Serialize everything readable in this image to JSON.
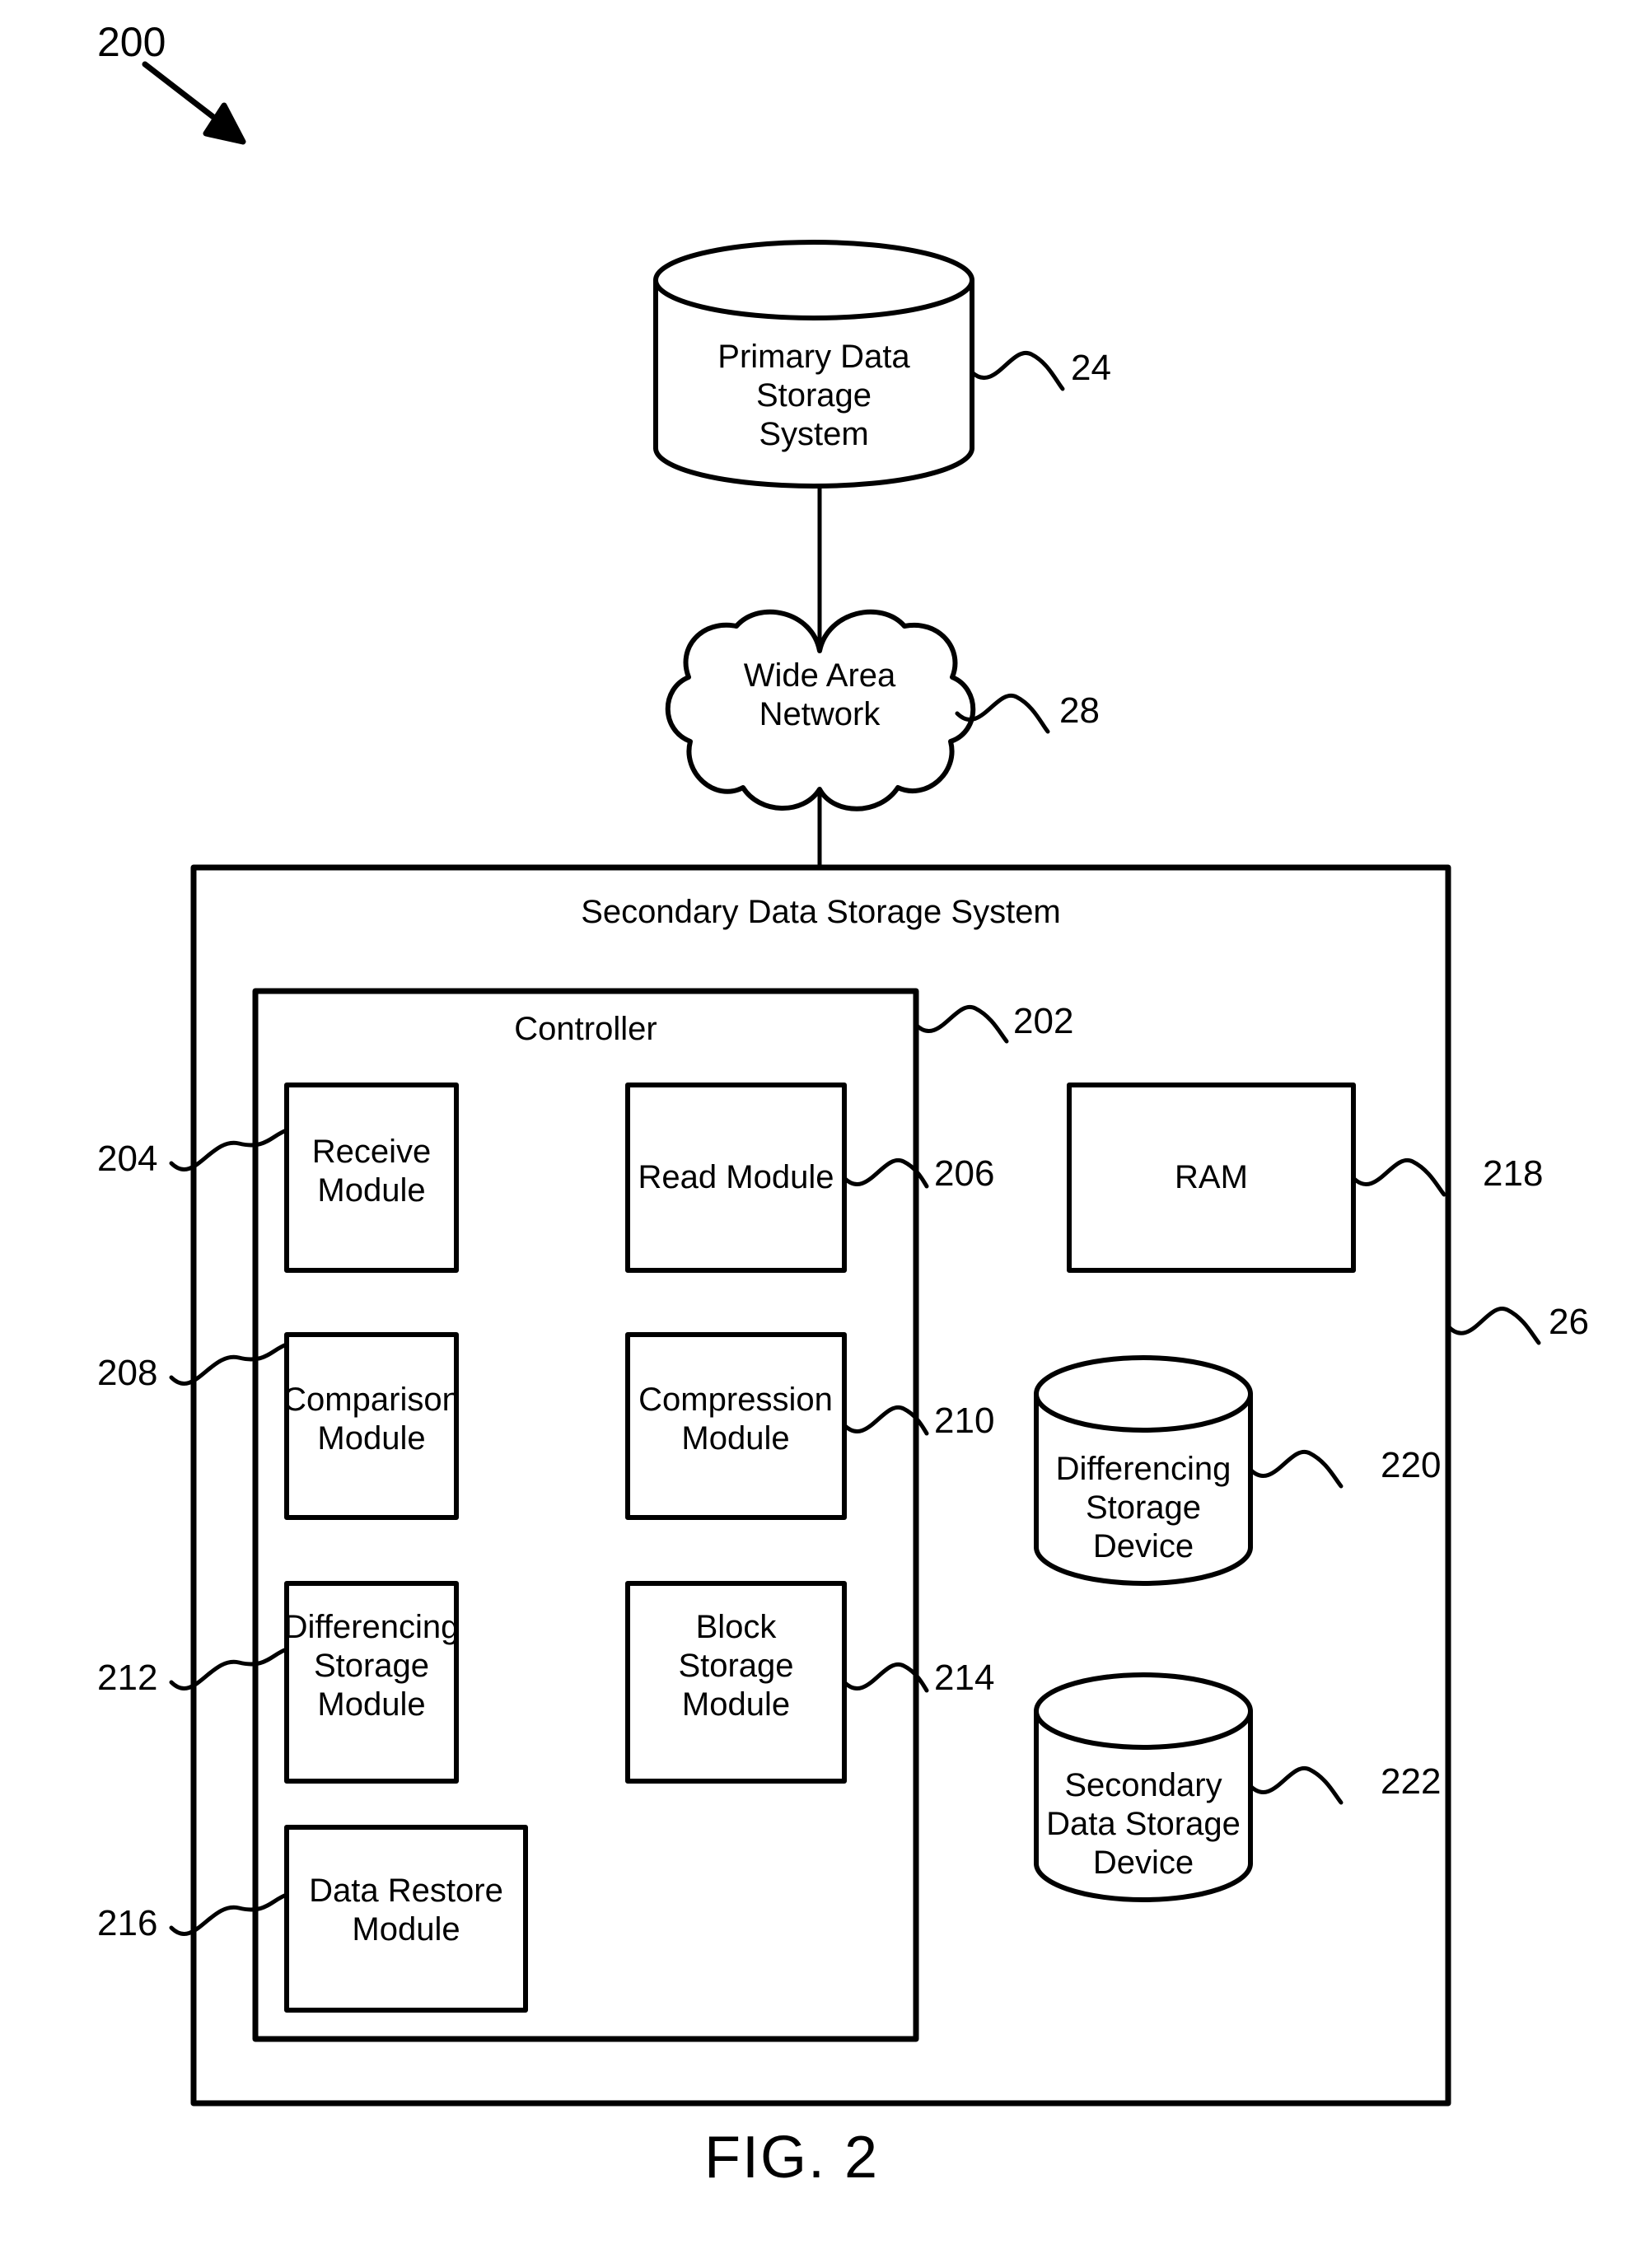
{
  "figure": {
    "number_label": "200",
    "caption": "FIG. 2"
  },
  "nodes": {
    "primary_storage": {
      "label": "Primary Data\nStorage\nSystem",
      "ref": "24"
    },
    "wan": {
      "label": "Wide Area\nNetwork",
      "ref": "28"
    },
    "secondary_system": {
      "label": "Secondary Data Storage System",
      "ref": "26"
    },
    "controller": {
      "label": "Controller",
      "ref": "202"
    }
  },
  "modules": [
    {
      "label": "Receive\nModule",
      "ref": "204",
      "ref_side": "left"
    },
    {
      "label": "Read Module",
      "ref": "206",
      "ref_side": "right"
    },
    {
      "label": "Comparison\nModule",
      "ref": "208",
      "ref_side": "left"
    },
    {
      "label": "Compression\nModule",
      "ref": "210",
      "ref_side": "right"
    },
    {
      "label": "Differencing\nStorage\nModule",
      "ref": "212",
      "ref_side": "left"
    },
    {
      "label": "Block\nStorage\nModule",
      "ref": "214",
      "ref_side": "right"
    },
    {
      "label": "Data Restore\nModule",
      "ref": "216",
      "ref_side": "left"
    }
  ],
  "hardware": [
    {
      "label": "RAM",
      "ref": "218",
      "shape": "rect"
    },
    {
      "label": "Differencing\nStorage\nDevice",
      "ref": "220",
      "shape": "cylinder"
    },
    {
      "label": "Secondary\nData Storage\nDevice",
      "ref": "222",
      "shape": "cylinder"
    }
  ],
  "colors": {
    "ink": "#000000",
    "paper": "#ffffff"
  }
}
